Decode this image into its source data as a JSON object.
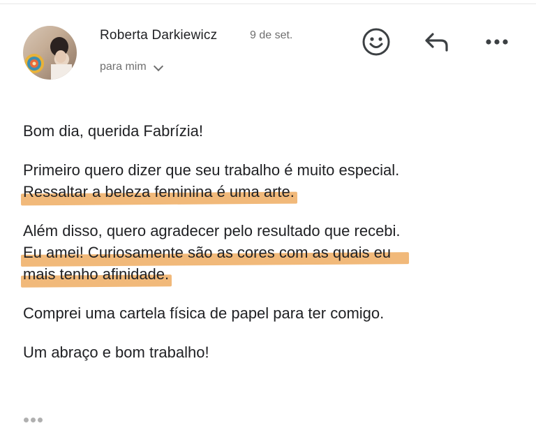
{
  "header": {
    "sender_name": "Roberta Darkiewicz",
    "date": "9 de set.",
    "recipient": "para mim"
  },
  "actions": {
    "emoji_icon": "smiley-icon",
    "reply_icon": "reply-arrow-icon",
    "more_icon": "more-horizontal-icon"
  },
  "message": {
    "greeting": "Bom dia, querida Fabrízia!",
    "p1_line1": "Primeiro quero dizer que seu trabalho é muito especial.",
    "p1_line2": "Ressaltar a beleza feminina é uma arte.",
    "p2_line1": "Além disso, quero agradecer pelo resultado que recebi.",
    "p2_line2": "Eu amei! Curiosamente são as cores com as quais eu",
    "p2_line3": "mais tenho afinidade.",
    "p3": "Comprei uma cartela física de papel para ter comigo.",
    "closing": "Um abraço e bom trabalho!"
  },
  "colors": {
    "highlight": "#f0b36f",
    "text": "#202124",
    "muted": "#6f6f6f"
  }
}
